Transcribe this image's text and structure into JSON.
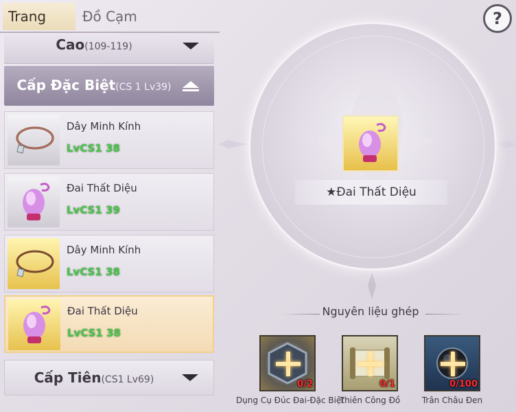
{
  "tabs": {
    "active": "Trang Sức",
    "inactive": "Đồ Cạm"
  },
  "help": "?",
  "list": {
    "top_category": {
      "label": "Cao",
      "sub": "(109-119)"
    },
    "special_category": {
      "label": "Cấp Đặc Biệt",
      "sub": "(CS 1 Lv39)"
    },
    "items": [
      {
        "name": "Dây Minh Kính",
        "level": "LvCS1 38",
        "icon": "necklace-icon"
      },
      {
        "name": "Đai Thất Diệu",
        "level": "LvCS1 39",
        "icon": "pouch-icon"
      },
      {
        "name": "Dây Minh Kính",
        "level": "LvCS1 38",
        "icon": "necklace-icon"
      },
      {
        "name": "Đai Thất Diệu",
        "level": "LvCS1 38",
        "icon": "pouch-icon"
      }
    ],
    "bottom_category": {
      "label": "Cấp Tiên",
      "sub": "(CS1 Lv69)"
    }
  },
  "preview": {
    "name": "★Đai Thất Diệu",
    "icon": "pouch-icon"
  },
  "materials": {
    "title": "Nguyên liệu ghép",
    "items": [
      {
        "label": "Dụng Cụ Đúc Đai-Đặc Biệt",
        "count": "0/2",
        "icon": "forge-tool-icon"
      },
      {
        "label": "Thiên Công Đồ",
        "count": "0/1",
        "icon": "scroll-icon"
      },
      {
        "label": "Trân Châu Đen",
        "count": "0/100",
        "icon": "black-pearl-icon"
      }
    ]
  }
}
